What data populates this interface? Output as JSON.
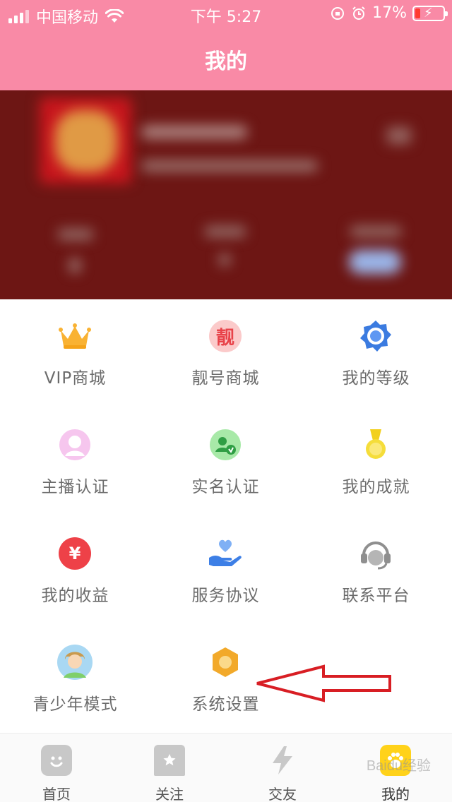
{
  "status_bar": {
    "carrier": "中国移动",
    "time": "下午 5:27",
    "battery_percent": "17%",
    "signal_icon": "signal-icon",
    "wifi_icon": "wifi-icon",
    "rotation_lock_icon": "rotation-lock-icon",
    "alarm_icon": "alarm-icon",
    "battery_icon": "battery-charging-icon"
  },
  "header": {
    "title": "我的",
    "background": "#f98aa6"
  },
  "menu": [
    {
      "label": "VIP商城",
      "icon": "crown-icon"
    },
    {
      "label": "靓号商城",
      "icon": "pretty-number-icon",
      "glyph": "靓"
    },
    {
      "label": "我的等级",
      "icon": "level-badge-icon"
    },
    {
      "label": "主播认证",
      "icon": "anchor-certification-icon"
    },
    {
      "label": "实名认证",
      "icon": "realname-verification-icon"
    },
    {
      "label": "我的成就",
      "icon": "medal-icon"
    },
    {
      "label": "我的收益",
      "icon": "yuan-coin-icon",
      "glyph": "¥"
    },
    {
      "label": "服务协议",
      "icon": "heart-hand-icon"
    },
    {
      "label": "联系平台",
      "icon": "headset-icon"
    },
    {
      "label": "青少年模式",
      "icon": "teen-mode-icon"
    },
    {
      "label": "系统设置",
      "icon": "settings-hexagon-icon"
    }
  ],
  "tabs": [
    {
      "label": "首页",
      "icon": "home-face-icon",
      "active": false
    },
    {
      "label": "关注",
      "icon": "star-bookmark-icon",
      "active": false
    },
    {
      "label": "交友",
      "icon": "lightning-icon",
      "active": false
    },
    {
      "label": "我的",
      "icon": "paw-icon",
      "active": true
    }
  ],
  "watermark": "Baidu经验",
  "colors": {
    "accent_pink": "#f98aa6",
    "active_tab": "#ffd21a",
    "annotation_arrow": "#d81e24"
  }
}
